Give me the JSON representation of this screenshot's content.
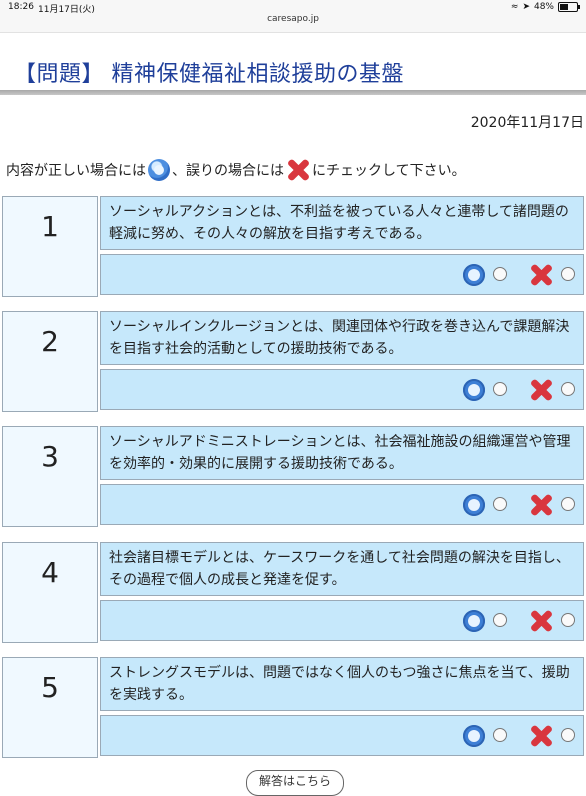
{
  "status_bar": {
    "time": "18:26",
    "date": "11月17日(火)",
    "url": "caresapo.jp",
    "battery": "48%"
  },
  "page": {
    "title": "【問題】 精神保健福祉相談援助の基盤",
    "date": "2020年11月17日",
    "instruction_a": "内容が正しい場合には",
    "instruction_b": "、誤りの場合には",
    "instruction_c": "にチェックして下さい。"
  },
  "colors": {
    "title": "#1f3f9a",
    "panel": "#c6e8fb",
    "number_panel": "#f0f9ff",
    "correct_icon": "#3d7fd6",
    "wrong_icon": "#d9363e"
  },
  "icons": {
    "correct": "blue-circle-icon",
    "wrong": "red-cross-icon"
  },
  "questions": [
    {
      "number": "1",
      "text": "ソーシャルアクションとは、不利益を被っている人々と連帯して諸問題の軽減に努め、その人々の解放を目指す考えである。"
    },
    {
      "number": "2",
      "text": "ソーシャルインクルージョンとは、関連団体や行政を巻き込んで課題解決を目指す社会的活動としての援助技術である。"
    },
    {
      "number": "3",
      "text": "ソーシャルアドミニストレーションとは、社会福祉施設の組織運営や管理を効率的・効果的に展開する援助技術である。"
    },
    {
      "number": "4",
      "text": "社会諸目標モデルとは、ケースワークを通して社会問題の解決を目指し、その過程で個人の成長と発達を促す。"
    },
    {
      "number": "5",
      "text": "ストレングスモデルは、問題ではなく個人のもつ強さに焦点を当て、援助を実践する。"
    }
  ],
  "footer": {
    "button_label": "解答はこちら"
  }
}
